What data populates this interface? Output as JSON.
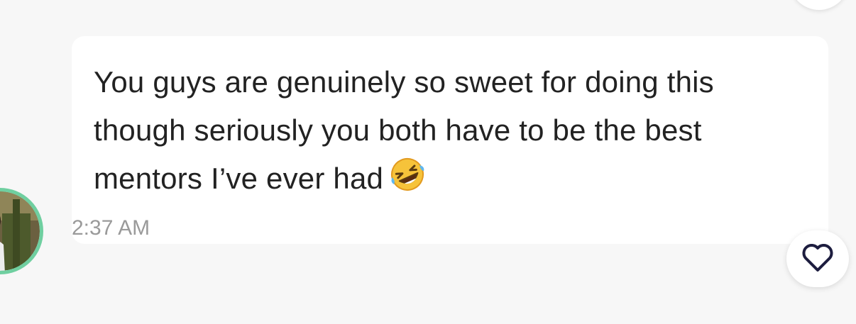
{
  "message": {
    "text": "You guys are genuinely so sweet for doing this though seriously you both have to be the best mentors I’ve ever had",
    "emoji": "rolling-on-the-floor-laughing-emoji",
    "timestamp": "2:37 AM"
  },
  "avatar": {
    "ring_color": "#6fcfa0"
  },
  "reactions": {
    "like_icon": "heart-outline-icon",
    "like_icon_color": "#1d1d3f"
  }
}
